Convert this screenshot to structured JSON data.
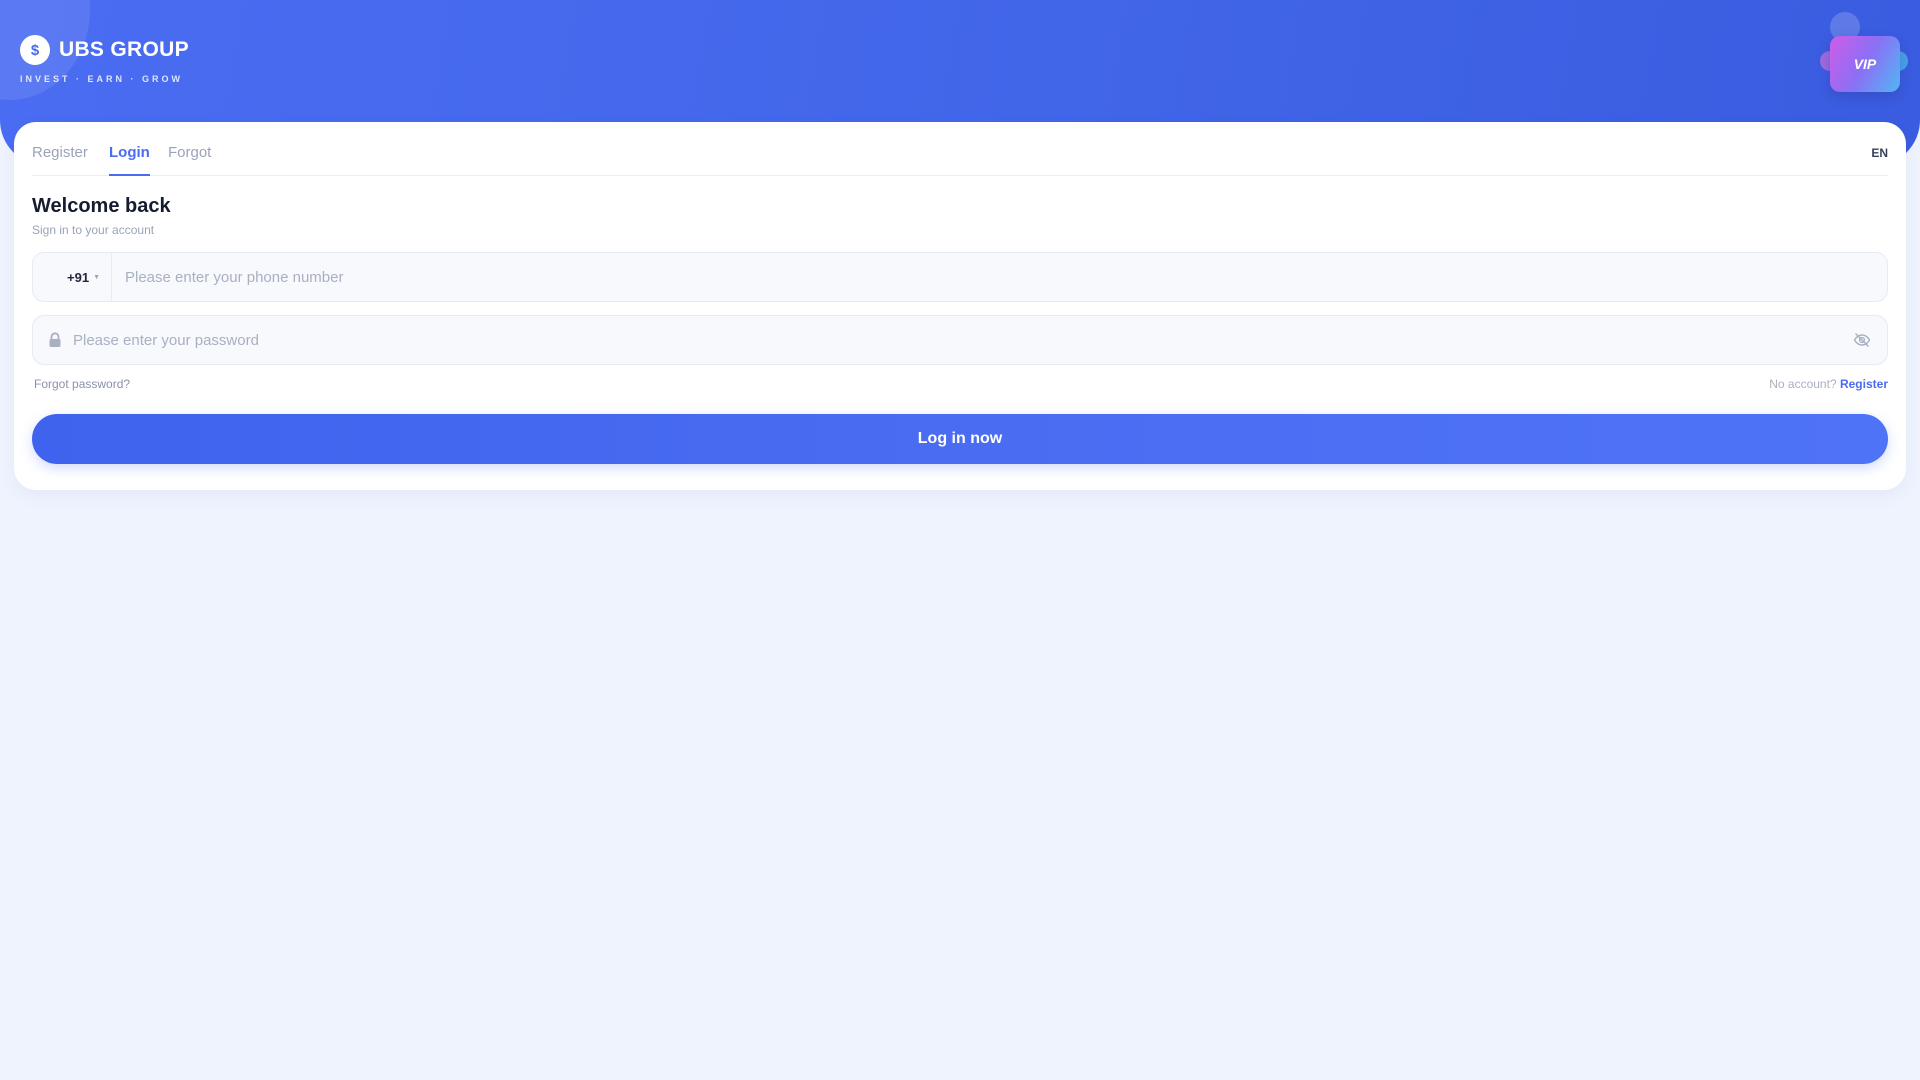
{
  "brand": {
    "coin_symbol": "$",
    "name": "UBS GROUP",
    "tagline": "INVEST · EARN · GROW"
  },
  "vip": {
    "label": "VIP"
  },
  "tabs": [
    {
      "label": "Register",
      "active": false
    },
    {
      "label": "Login",
      "active": true
    },
    {
      "label": "Forgot",
      "active": false
    }
  ],
  "language": "EN",
  "form": {
    "title": "Welcome back",
    "subtitle": "Sign in to your account",
    "country_code": "+91",
    "phone_placeholder": "Please enter your phone number",
    "password_placeholder": "Please enter your password",
    "forgot_password": "Forgot password?",
    "no_account": "No account?",
    "register_link": "Register",
    "submit_label": "Log in now"
  },
  "icons": {
    "lock": "lock-icon",
    "password_visibility": "eye-off-icon",
    "country_dropdown": "caret-down-icon"
  },
  "colors": {
    "accent": "#4a6cf2",
    "background": "#eef3fe",
    "card": "#ffffff"
  }
}
